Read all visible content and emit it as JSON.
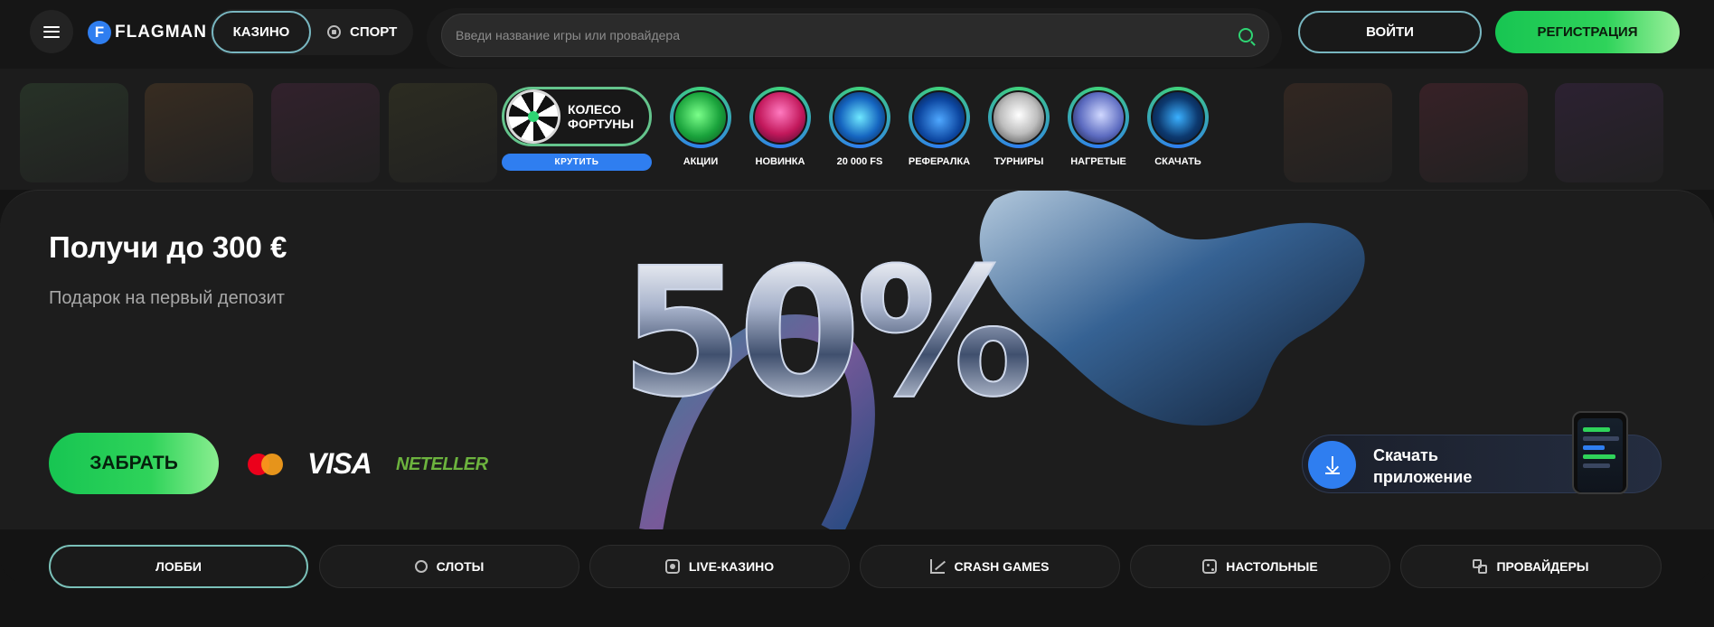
{
  "header": {
    "logo_letter": "F",
    "logo_text": "FLAGMAN",
    "nav": {
      "casino": "КАЗИНО",
      "sport": "СПОРТ"
    },
    "search": {
      "placeholder": "Введи название игры или провайдера",
      "value": ""
    },
    "login_label": "ВОЙТИ",
    "register_label": "РЕГИСТРАЦИЯ"
  },
  "stories": {
    "wheel": {
      "label_line1": "КОЛЕСО",
      "label_line2": "ФОРТУНЫ",
      "spin_label": "КРУТИТЬ"
    },
    "items": [
      {
        "label": "АКЦИИ",
        "icon": "piggy-bank-icon"
      },
      {
        "label": "НОВИНКА",
        "icon": "new-game-icon"
      },
      {
        "label": "20 000 FS",
        "icon": "vr-goggles-icon"
      },
      {
        "label": "РЕФЕРАЛКА",
        "icon": "money-bag-icon"
      },
      {
        "label": "ТУРНИРЫ",
        "icon": "trophy-icon"
      },
      {
        "label": "НАГРЕТЫЕ",
        "icon": "rocket-icon"
      },
      {
        "label": "СКАЧАТЬ",
        "icon": "phone-app-icon"
      }
    ]
  },
  "banner": {
    "title": "Получи до 300 €",
    "subtitle": "Подарок на первый депозит",
    "big_number": "50%",
    "claim_label": "ЗАБРАТЬ",
    "payments": {
      "visa": "VISA",
      "neteller": "NETELLER"
    },
    "app": {
      "line1": "Скачать",
      "line2": "приложение"
    }
  },
  "tabs": [
    {
      "label": "ЛОББИ",
      "active": true
    },
    {
      "label": "СЛОТЫ",
      "icon": "cherries-icon"
    },
    {
      "label": "LIVE-КАЗИНО",
      "icon": "live-icon"
    },
    {
      "label": "CRASH GAMES",
      "icon": "chart-icon"
    },
    {
      "label": "НАСТОЛЬНЫЕ",
      "icon": "dice-icon"
    },
    {
      "label": "ПРОВАЙДЕРЫ",
      "icon": "grid-icon"
    }
  ],
  "colors": {
    "accent_green": "#2fd35a",
    "accent_blue": "#2f7ef0",
    "background": "#141414",
    "outline_teal": "#78b6c0"
  }
}
